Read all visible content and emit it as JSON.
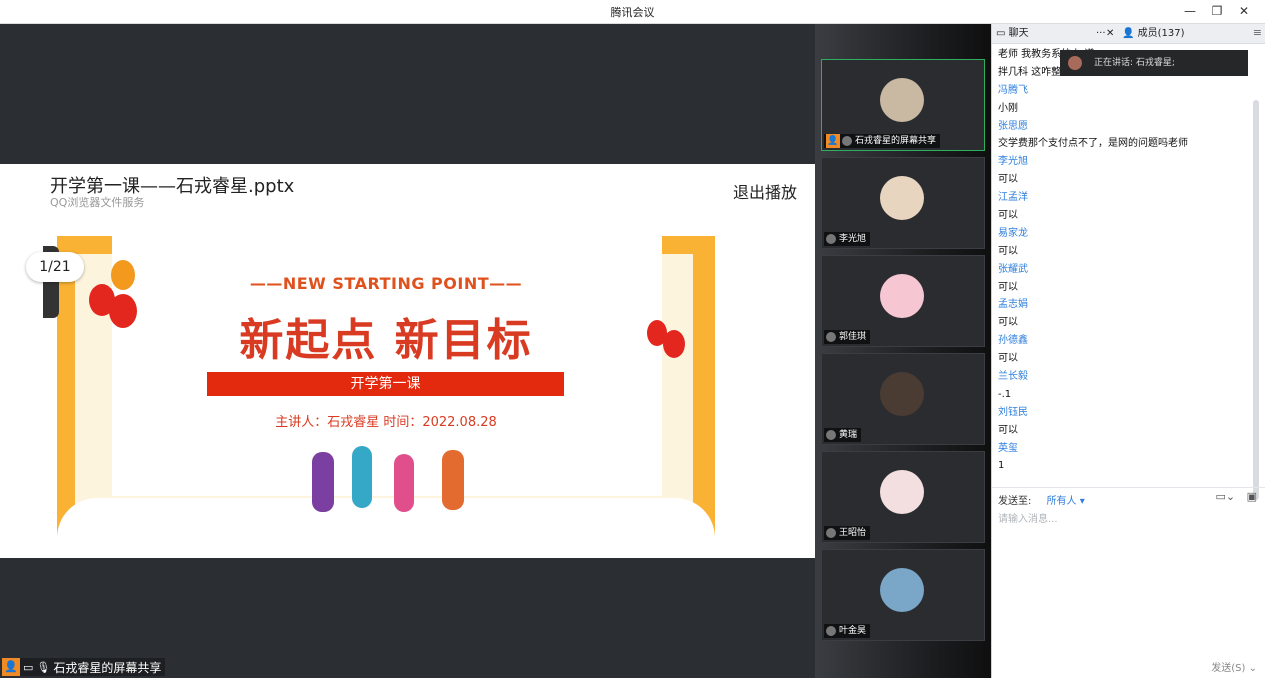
{
  "window": {
    "title": "腾讯会议",
    "minimize": "—",
    "maximize": "❐",
    "close": "✕"
  },
  "viewer": {
    "file_name": "开学第一课——石戎睿星.pptx",
    "file_sub": "QQ浏览器文件服务",
    "exit_label": "退出播放",
    "page_indicator": "1/21"
  },
  "slide": {
    "tag": "——NEW STARTING POINT——",
    "title": "新起点 新目标",
    "bar": "开学第一课",
    "speaker_line": "主讲人：石戎睿星   时间：2022.08.28"
  },
  "share_status": {
    "label": "石戎睿星的屏幕共享"
  },
  "videos": [
    {
      "name": "石戎睿星的屏幕共享",
      "active": true,
      "color": "#c9b8a2"
    },
    {
      "name": "李光旭",
      "active": false,
      "color": "#e8d5c0"
    },
    {
      "name": "郭佳琪",
      "active": false,
      "color": "#f6c6d3"
    },
    {
      "name": "黄瑞",
      "active": false,
      "color": "#4a3c33"
    },
    {
      "name": "王昭怡",
      "active": false,
      "color": "#f3dfe0"
    },
    {
      "name": "叶金昊",
      "active": false,
      "color": "#7aa6c7"
    }
  ],
  "chat": {
    "tab_chat": "聊天",
    "tab_more": "···",
    "tab_members": "成员(137)",
    "speaking_now": "正在讲话: 石戎睿星;",
    "messages": [
      {
        "type": "text",
        "content": "老师 我教务系统上                              道"
      },
      {
        "type": "text",
        "content": "拌几科 这咋整"
      },
      {
        "type": "name",
        "content": "冯腾飞"
      },
      {
        "type": "text",
        "content": "小刚"
      },
      {
        "type": "name",
        "content": "张思愿"
      },
      {
        "type": "text",
        "content": "交学费那个支付点不了，是网的问题吗老师"
      },
      {
        "type": "name",
        "content": "李光旭"
      },
      {
        "type": "text",
        "content": "可以"
      },
      {
        "type": "name",
        "content": "江孟洋"
      },
      {
        "type": "text",
        "content": "可以"
      },
      {
        "type": "name",
        "content": "易家龙"
      },
      {
        "type": "text",
        "content": "可以"
      },
      {
        "type": "name",
        "content": "张耀武"
      },
      {
        "type": "text",
        "content": "可以"
      },
      {
        "type": "name",
        "content": "孟志娟"
      },
      {
        "type": "text",
        "content": "可以"
      },
      {
        "type": "name",
        "content": "   孙德鑫"
      },
      {
        "type": "text",
        "content": "可以"
      },
      {
        "type": "name",
        "content": "兰长毅"
      },
      {
        "type": "text",
        "content": "-.1"
      },
      {
        "type": "name",
        "content": "刘钰民"
      },
      {
        "type": "text",
        "content": "可以"
      },
      {
        "type": "name",
        "content": "英玺"
      },
      {
        "type": "text",
        "content": "1"
      }
    ],
    "send_to_label": "发送至:",
    "send_to_value": "所有人 ▾",
    "input_placeholder": "请输入消息...",
    "send_button": "发送(S) ⌄",
    "folder_icon": "▭⌄",
    "snapshot_icon": "▣"
  }
}
